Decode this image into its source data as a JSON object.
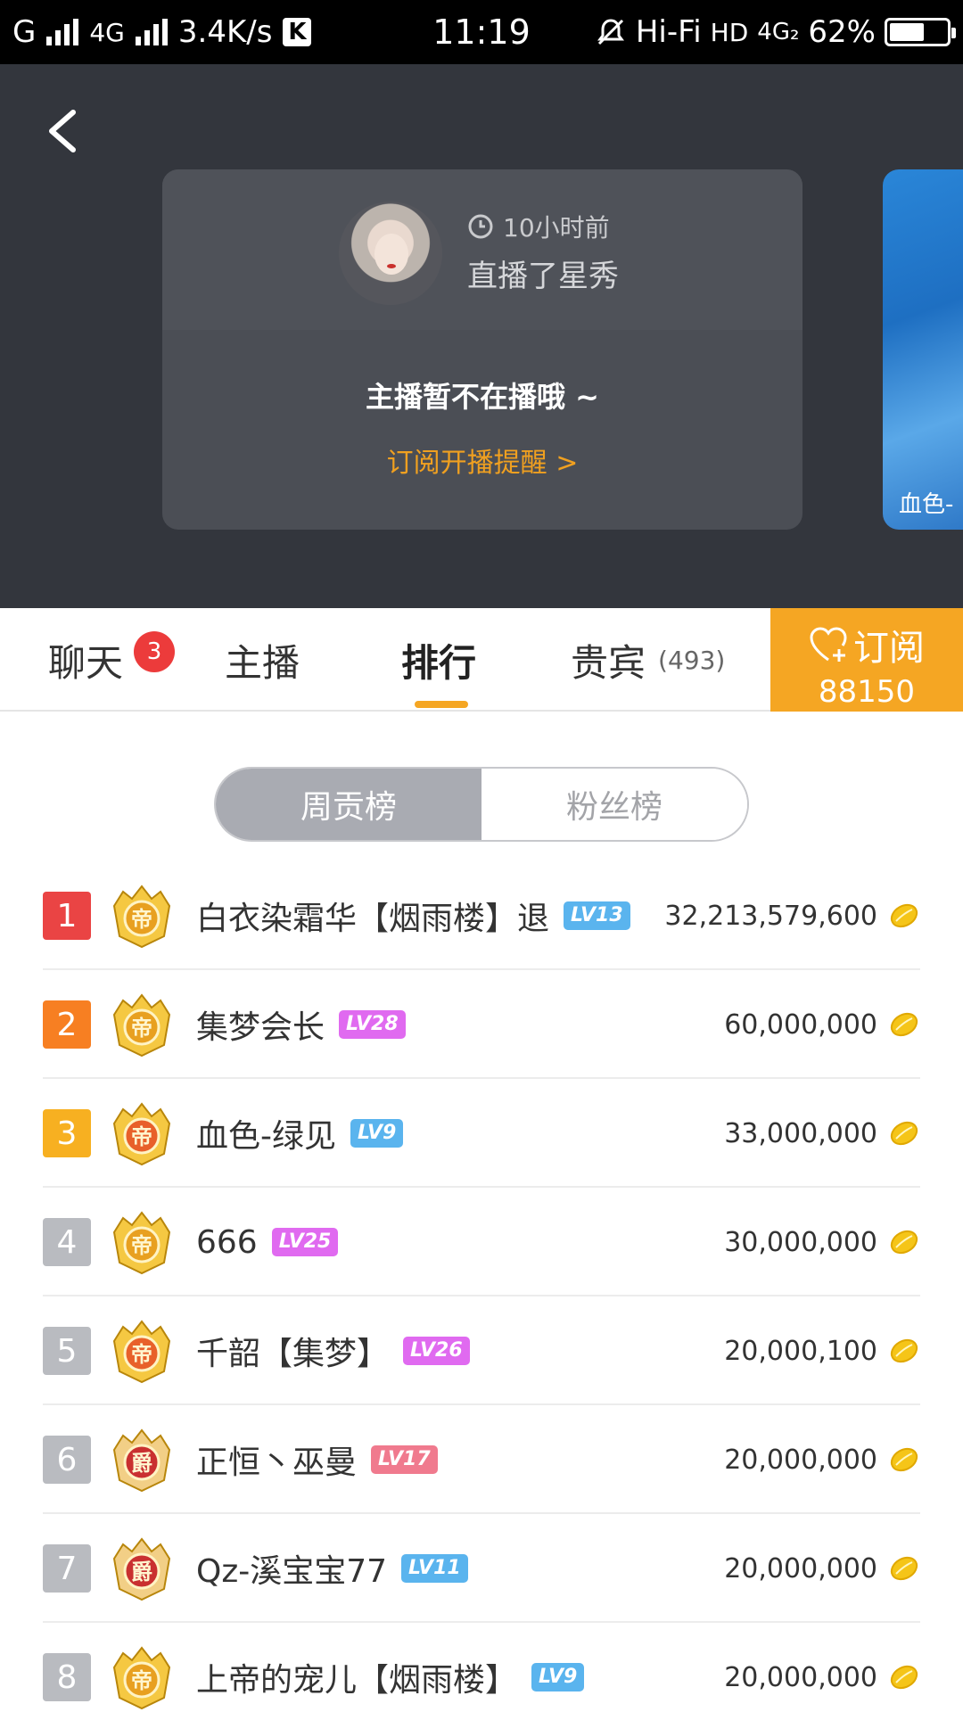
{
  "status_bar": {
    "carrier1": "G",
    "carrier2": "4G",
    "speed": "3.4K/s",
    "k_icon": "K",
    "time": "11:19",
    "hifi": "Hi-Fi",
    "hd": "HD",
    "net": "4G₂",
    "battery": "62%",
    "battery_level": 0.62
  },
  "header": {
    "time_ago": "10小时前",
    "live_desc": "直播了星秀",
    "offline": "主播暂不在播哦 ~",
    "remind": "订阅开播提醒 >",
    "side_card_label": "血色-"
  },
  "tabs": [
    {
      "label": "聊天",
      "badge": "3"
    },
    {
      "label": "主播"
    },
    {
      "label": "排行"
    },
    {
      "label": "贵宾",
      "count": "(493)"
    }
  ],
  "subscribe": {
    "label": "订阅",
    "count": "88150"
  },
  "segment": {
    "active": "周贡榜",
    "inactive": "粉丝榜"
  },
  "colors": {
    "accent": "#f5a623",
    "rank1": "#ea4444",
    "rank2": "#f77f22",
    "rank3": "#f7b021",
    "rank_other": "#b9bbc0",
    "lv_blue": "#5ab4ee",
    "lv_purple": "#e06af0",
    "lv_red": "#f07a8e"
  },
  "ranking": [
    {
      "rank": "1",
      "name": "白衣染霜华【烟雨楼】退",
      "level": "LV13",
      "score": "32,213,579,600",
      "medal": "emperor-gold-medal-icon"
    },
    {
      "rank": "2",
      "name": "集梦会长",
      "level": "LV28",
      "score": "60,000,000",
      "medal": "emperor-gold-medal-icon"
    },
    {
      "rank": "3",
      "name": "血色-绿见",
      "level": "LV9",
      "score": "33,000,000",
      "medal": "emperor-orange-medal-icon"
    },
    {
      "rank": "4",
      "name": "666",
      "level": "LV25",
      "score": "30,000,000",
      "medal": "emperor-gold-medal-icon"
    },
    {
      "rank": "5",
      "name": "千韶【集梦】",
      "level": "LV26",
      "score": "20,000,100",
      "medal": "emperor-orange-medal-icon"
    },
    {
      "rank": "6",
      "name": "正恒丶巫曼",
      "level": "LV17",
      "score": "20,000,000",
      "medal": "duke-medal-icon"
    },
    {
      "rank": "7",
      "name": "Qz-溪宝宝77",
      "level": "LV11",
      "score": "20,000,000",
      "medal": "duke-medal-icon"
    },
    {
      "rank": "8",
      "name": "上帝的宠儿【烟雨楼】",
      "level": "LV9",
      "score": "20,000,000",
      "medal": "emperor-gold-medal-icon"
    }
  ],
  "medal_text": {
    "emperor": "帝",
    "duke": "爵"
  }
}
